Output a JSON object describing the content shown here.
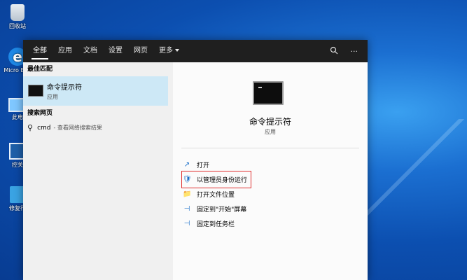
{
  "desktop": {
    "icons": [
      {
        "label": "回收站"
      },
      {
        "label": "Micro Edg"
      },
      {
        "label": "此电"
      },
      {
        "label": "控关"
      },
      {
        "label": "修复行"
      }
    ]
  },
  "topbar": {
    "tabs": [
      "全部",
      "应用",
      "文档",
      "设置",
      "网页",
      "更多"
    ],
    "feedback_icon": "feedback-icon",
    "more_icon": "···"
  },
  "left": {
    "best_match_header": "最佳匹配",
    "best_match": {
      "title": "命令提示符",
      "subtitle": "应用"
    },
    "search_web_header": "搜索网页",
    "web_item": {
      "query": "cmd",
      "sub": "- 查看网络搜索结果"
    }
  },
  "right": {
    "title": "命令提示符",
    "subtitle": "应用",
    "actions": [
      {
        "icon": "↗",
        "label": "打开"
      },
      {
        "icon": "🛡",
        "label": "以管理员身份运行"
      },
      {
        "icon": "📁",
        "label": "打开文件位置"
      },
      {
        "icon": "⊣",
        "label": "固定到\"开始\"屏幕"
      },
      {
        "icon": "⊣",
        "label": "固定到任务栏"
      }
    ]
  }
}
